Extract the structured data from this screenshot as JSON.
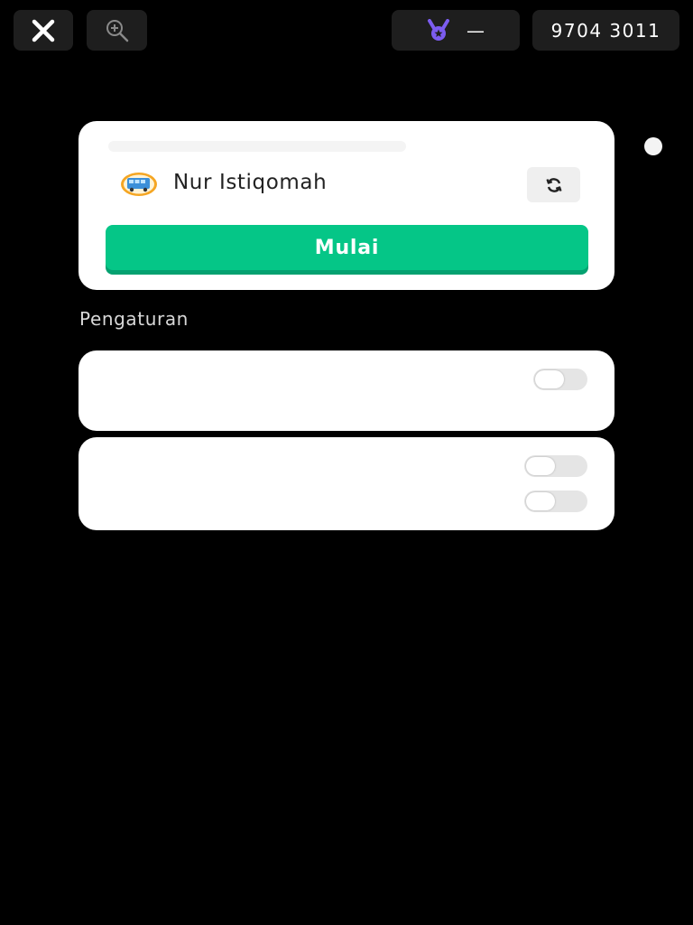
{
  "toolbar": {
    "close_icon": "close-icon",
    "zoom_icon": "zoom-in-icon",
    "medal_icon": "medal-icon",
    "medal_value": "—",
    "game_code": "9704 3011"
  },
  "join_card": {
    "player_name": "Nur Istiqomah",
    "avatar_icon": "bus-avatar-icon",
    "refresh_icon": "refresh-icon",
    "start_label": "Mulai"
  },
  "settings": {
    "title": "Pengaturan",
    "toggles": [
      {
        "state": "off"
      },
      {
        "state": "off"
      },
      {
        "state": "off"
      }
    ]
  },
  "colors": {
    "accent": "#05c687",
    "accent_shadow": "#04a170",
    "medal": "#7c5cf0",
    "background": "#000000"
  }
}
